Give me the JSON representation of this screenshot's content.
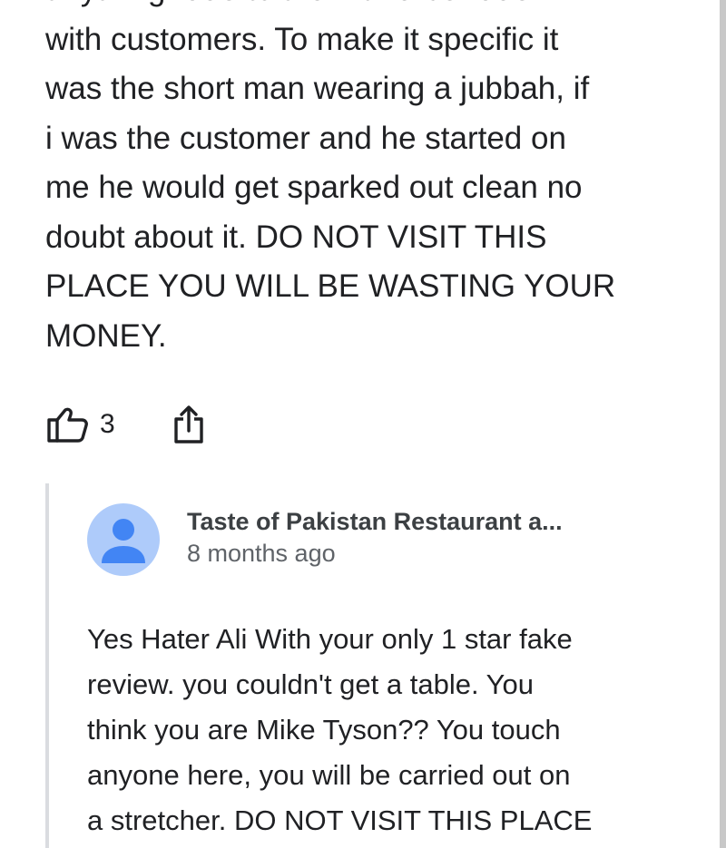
{
  "review": {
    "text": "anything rude to them and be rude\nwith customers. To make it specific it\nwas the short man wearing a jubbah, if\ni was the customer and he started on\nme he would get sparked out clean no\ndoubt about it. DO NOT VISIT THIS\nPLACE YOU WILL BE WASTING YOUR\nMONEY.",
    "like_count": "3",
    "like_icon": "thumbs-up-icon",
    "share_icon": "share-icon"
  },
  "owner_reply": {
    "avatar_icon": "person-icon",
    "avatar_color": "#aecbfa",
    "avatar_glyph_color": "#4285f4",
    "name": "Taste of Pakistan Restaurant a...",
    "time": "8 months ago",
    "text": "Yes Hater Ali With your only 1 star fake\nreview. you couldn't get a table. You\nthink you are Mike Tyson?? You touch\nanyone here, you will be carried out on\na stretcher. DO NOT VISIT THIS PLACE"
  },
  "colors": {
    "text": "#202124",
    "secondary_text": "#5f6368",
    "divider": "#dadce0"
  }
}
